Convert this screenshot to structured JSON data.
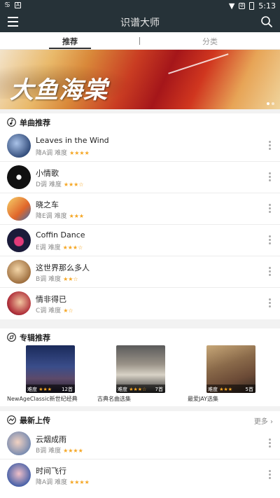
{
  "statusbar": {
    "left_icons": [
      "mascot-icon",
      "a-icon"
    ],
    "time": "5:13"
  },
  "appbar": {
    "title": "识谱大师"
  },
  "tabs": {
    "recommend": "推荐",
    "category": "分类"
  },
  "banner": {
    "title": "大鱼海棠"
  },
  "singles": {
    "title": "单曲推荐",
    "items": [
      {
        "name": "Leaves in the Wind",
        "key": "降A调",
        "level_label": "难度",
        "stars": "★★★★"
      },
      {
        "name": " 小情歌",
        "key": "D调",
        "level_label": "难度",
        "stars": "★★★☆"
      },
      {
        "name": "晓之车",
        "key": "降E调",
        "level_label": "难度",
        "stars": "★★★"
      },
      {
        "name": "Coffin Dance",
        "key": "E调",
        "level_label": "难度",
        "stars": "★★★☆"
      },
      {
        "name": "这世界那么多人",
        "key": "B调",
        "level_label": "难度",
        "stars": "★★☆"
      },
      {
        "name": "情非得已",
        "key": "C调",
        "level_label": "难度",
        "stars": "★☆"
      }
    ]
  },
  "albums": {
    "title": "专辑推荐",
    "items": [
      {
        "name": "NewAgeClassic新世纪经典",
        "level_label": "难度",
        "stars": "★★★",
        "count": "12首"
      },
      {
        "name": "古典名曲选集",
        "level_label": "难度",
        "stars": "★★★☆",
        "count": "7首"
      },
      {
        "name": "最爱JAY选集",
        "level_label": "难度",
        "stars": "★★★",
        "count": "5首"
      }
    ]
  },
  "latest": {
    "title": "最新上传",
    "more": "更多",
    "items": [
      {
        "name": "云烟成雨",
        "key": "B调",
        "level_label": "难度",
        "stars": "★★★★"
      },
      {
        "name": "时间飞行",
        "key": "降A调",
        "level_label": "难度",
        "stars": "★★★★"
      }
    ]
  },
  "colors": {
    "appbar": "#263238",
    "star": "#f5a623",
    "background": "#f2f2f2"
  }
}
